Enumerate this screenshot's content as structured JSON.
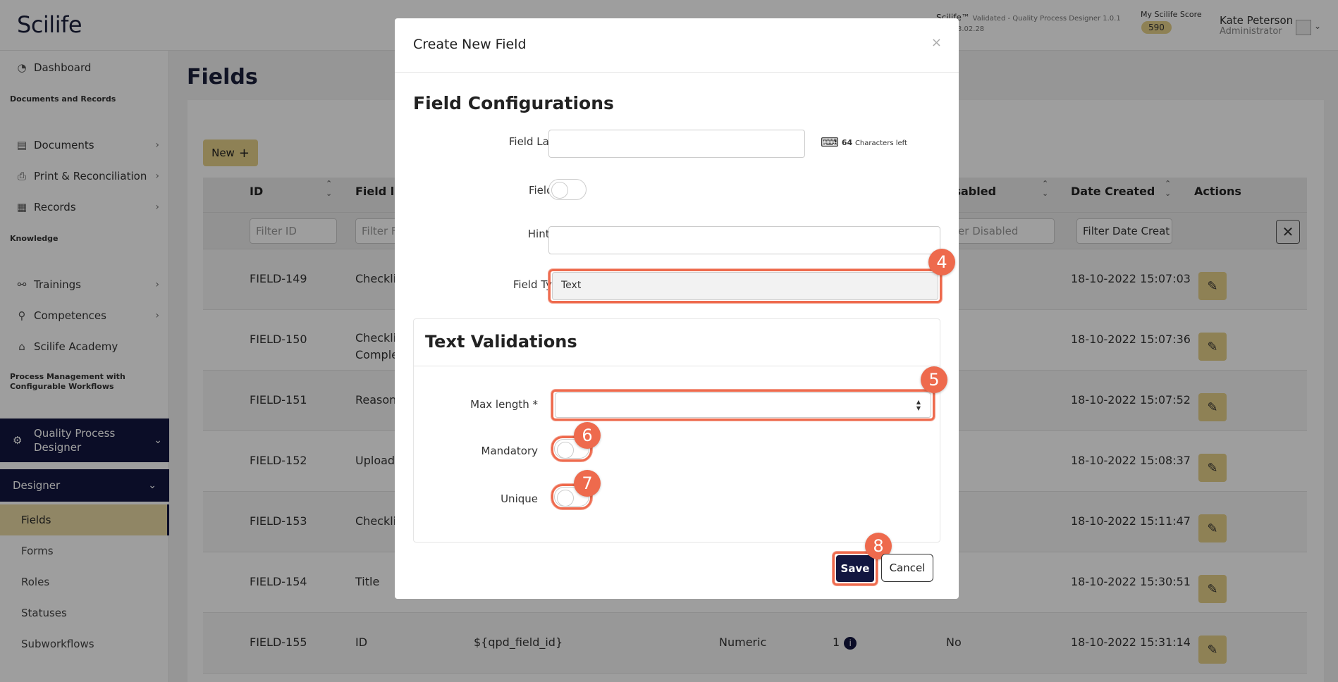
{
  "header": {
    "logo": "Scilife",
    "product": "Scilife™",
    "product_sub": "Validated - Quality Process Designer 1.0.1",
    "version": "3.02.28",
    "score_label": "My Scilife Score",
    "score_value": "590",
    "user_name": "Kate Peterson",
    "user_role": "Administrator"
  },
  "sidebar": {
    "dashboard": "Dashboard",
    "section_docs": "Documents and Records",
    "documents": "Documents",
    "print": "Print & Reconciliation",
    "records": "Records",
    "section_knowledge": "Knowledge",
    "trainings": "Trainings",
    "competences": "Competences",
    "academy": "Scilife Academy",
    "section_process": "Process Management with Configurable Workflows",
    "qpd": "Quality Process Designer",
    "designer": "Designer",
    "sub": [
      "Fields",
      "Forms",
      "Roles",
      "Statuses",
      "Subworkflows"
    ]
  },
  "page": {
    "title": "Fields",
    "new_button": "New",
    "columns": {
      "id": "ID",
      "label": "Field la",
      "disabled": "isabled",
      "date": "Date Created",
      "actions": "Actions"
    },
    "filters": {
      "id": "Filter ID",
      "label": "Filter F",
      "disabled": "lter Disabled",
      "date": "Filter Date Creat"
    },
    "rows": [
      {
        "id": "FIELD-149",
        "label": "Checkli",
        "label2": "",
        "date": "18-10-2022 15:07:03"
      },
      {
        "id": "FIELD-150",
        "label": "Checkli",
        "label2": "Comple",
        "date": "18-10-2022 15:07:36"
      },
      {
        "id": "FIELD-151",
        "label": "Reason",
        "label2": "",
        "date": "18-10-2022 15:07:52"
      },
      {
        "id": "FIELD-152",
        "label": "Upload",
        "label2": "",
        "date": "18-10-2022 15:08:37"
      },
      {
        "id": "FIELD-153",
        "label": "Checkli",
        "label2": "",
        "date": "18-10-2022 15:11:47"
      },
      {
        "id": "FIELD-154",
        "label": "Title",
        "label2": "",
        "date": "18-10-2022 15:30:51"
      },
      {
        "id": "FIELD-155",
        "label": "ID",
        "label2": "",
        "date": "18-10-2022 15:31:14",
        "system": "${qpd_field_id}",
        "type": "Numeric",
        "count": "1",
        "disabled": "No"
      }
    ]
  },
  "modal": {
    "title": "Create New Field",
    "close": "×",
    "section": "Field Configurations",
    "field_label": "Field Label *",
    "chars_count": "64",
    "chars_text": "Characters left",
    "field_set": "Field Set",
    "hint_text": "Hint text",
    "field_type": "Field Type *",
    "field_type_value": "Text",
    "validations_title": "Text Validations",
    "max_length": "Max length *",
    "mandatory": "Mandatory",
    "unique": "Unique",
    "save": "Save",
    "cancel": "Cancel"
  },
  "annotations": [
    "4",
    "5",
    "6",
    "7",
    "8"
  ],
  "colors": {
    "accent": "#e6d08a",
    "navy": "#121640",
    "highlight": "#ee6a4d"
  }
}
